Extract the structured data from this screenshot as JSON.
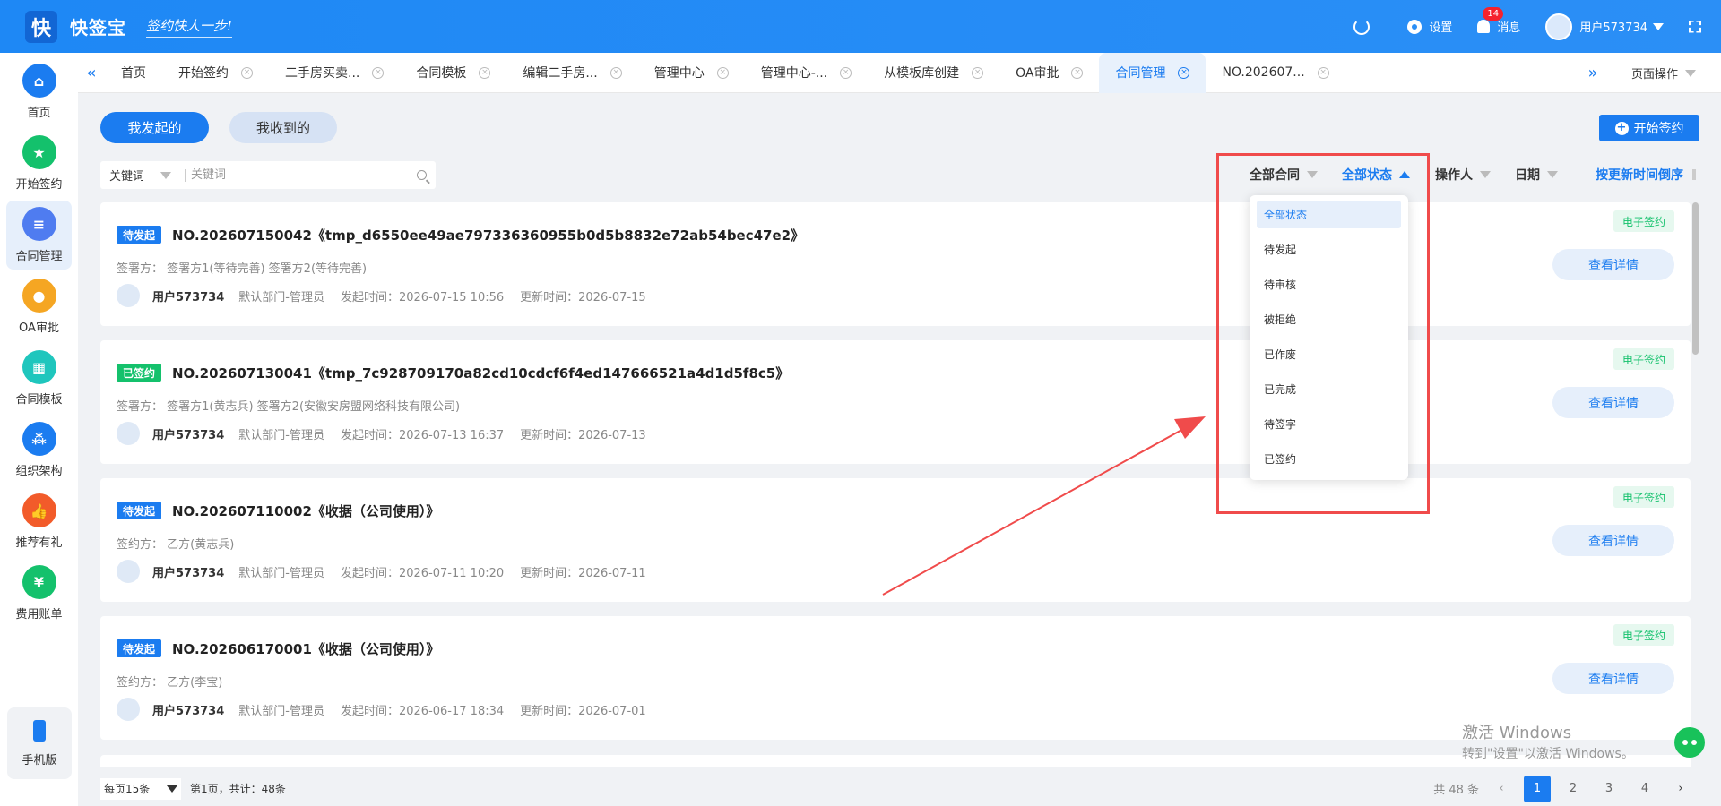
{
  "app": {
    "name": "快签宝",
    "slogan": "签约快人一步!",
    "logo_char": "快"
  },
  "topbar": {
    "settings": "设置",
    "messages": "消息",
    "message_count": "14",
    "user": "用户573734"
  },
  "sidebar": {
    "items": [
      {
        "label": "首页",
        "icon": "home-icon",
        "color": "#1b7cf0"
      },
      {
        "label": "开始签约",
        "icon": "sign-start-icon",
        "color": "#14c16c"
      },
      {
        "label": "合同管理",
        "icon": "contract-manage-icon",
        "color": "#4f7cf0"
      },
      {
        "label": "OA审批",
        "icon": "oa-approval-icon",
        "color": "#f5a623"
      },
      {
        "label": "合同模板",
        "icon": "template-icon",
        "color": "#1fc6bd"
      },
      {
        "label": "组织架构",
        "icon": "org-icon",
        "color": "#1b7cf0"
      },
      {
        "label": "推荐有礼",
        "icon": "thumb-up-icon",
        "color": "#f25b2a"
      },
      {
        "label": "费用账单",
        "icon": "bill-icon",
        "color": "#14c16c"
      }
    ],
    "mobile": "手机版"
  },
  "tabs": [
    {
      "label": "首页",
      "closable": false
    },
    {
      "label": "开始签约",
      "closable": true
    },
    {
      "label": "二手房买卖...",
      "closable": true
    },
    {
      "label": "合同模板",
      "closable": true
    },
    {
      "label": "编辑二手房...",
      "closable": true
    },
    {
      "label": "管理中心",
      "closable": true
    },
    {
      "label": "管理中心-...",
      "closable": true
    },
    {
      "label": "从模板库创建",
      "closable": true
    },
    {
      "label": "OA审批",
      "closable": true
    },
    {
      "label": "合同管理",
      "closable": true,
      "active": true
    },
    {
      "label": "NO.202607...",
      "closable": true
    }
  ],
  "page_ops": "页面操作",
  "segments": {
    "sent": "我发起的",
    "received": "我收到的"
  },
  "start_button": "开始签约",
  "search": {
    "select_label": "关键词",
    "placeholder": "关键词"
  },
  "filters": {
    "all_contracts": "全部合同",
    "all_status": "全部状态",
    "operator": "操作人",
    "date": "日期",
    "sort": "按更新时间倒序"
  },
  "status_dropdown": [
    "全部状态",
    "待发起",
    "待审核",
    "被拒绝",
    "已作废",
    "已完成",
    "待签字",
    "已签约"
  ],
  "cards": [
    {
      "status": "待发起",
      "status_type": "pending",
      "title": "NO.202607150042《tmp_d6550ee49ae797336360955b0d5b8832e72ab54bec47e2》",
      "parties": "签署方：  签署方1(等待完善) 签署方2(等待完善)",
      "user": "用户573734",
      "dept": "默认部门-管理员",
      "created": "发起时间：2026-07-15 10:56",
      "updated": "更新时间：2026-07-15",
      "tag": "电子签约",
      "action": "查看详情"
    },
    {
      "status": "已签约",
      "status_type": "signed",
      "title": "NO.202607130041《tmp_7c928709170a82cd10cdcf6f4ed147666521a4d1d5f8c5》",
      "parties": "签署方：  签署方1(黄志兵) 签署方2(安徽安房盟网络科技有限公司)",
      "user": "用户573734",
      "dept": "默认部门-管理员",
      "created": "发起时间：2026-07-13 16:37",
      "updated": "更新时间：2026-07-13",
      "tag": "电子签约",
      "action": "查看详情"
    },
    {
      "status": "待发起",
      "status_type": "pending",
      "title": "NO.202607110002《收据（公司使用）》",
      "parties": "签约方：  乙方(黄志兵)",
      "user": "用户573734",
      "dept": "默认部门-管理员",
      "created": "发起时间：2026-07-11 10:20",
      "updated": "更新时间：2026-07-11",
      "tag": "电子签约",
      "action": "查看详情"
    },
    {
      "status": "待发起",
      "status_type": "pending",
      "title": "NO.202606170001《收据（公司使用）》",
      "parties": "签约方：  乙方(李宝)",
      "user": "用户573734",
      "dept": "默认部门-管理员",
      "created": "发起时间：2026-06-17 18:34",
      "updated": "更新时间：2026-07-01",
      "tag": "电子签约",
      "action": "查看详情"
    }
  ],
  "pagination": {
    "per_page": "每页15条",
    "info": "第1页，共计：48条",
    "total": "共 48 条",
    "pages": [
      "1",
      "2",
      "3",
      "4"
    ],
    "current": "1"
  },
  "watermark": {
    "line1": "激活 Windows",
    "line2": "转到\"设置\"以激活 Windows。"
  }
}
